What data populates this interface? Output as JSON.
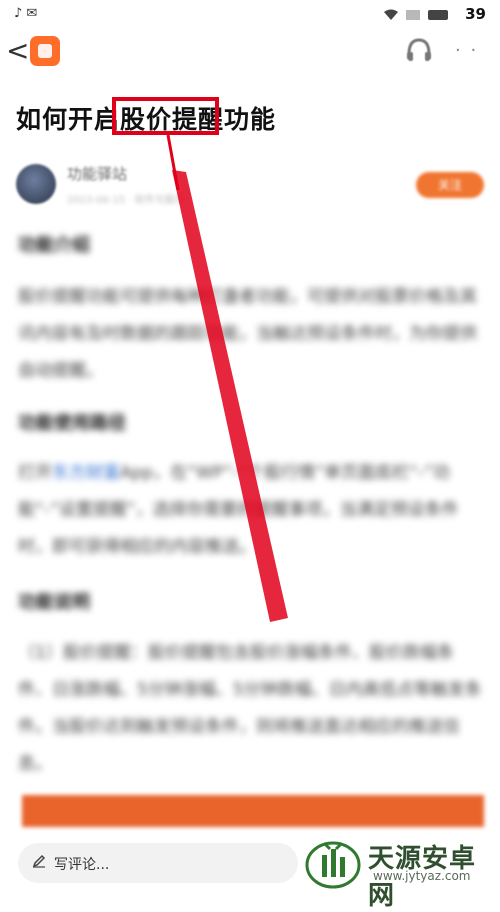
{
  "status": {
    "left_icons": "♪ ✉",
    "time": "39"
  },
  "nav": {
    "back": "<"
  },
  "article": {
    "title": "如何开启股价提醒功能",
    "author_name": "功能驿站",
    "author_meta": "2023-06-15 · 软件与服务",
    "follow_label": "关注",
    "h1": "功能介绍",
    "p1": "股价提醒功能可提供每种灯盏者功能，可提供对股票价格及其讯内容有及时数据的跟踪功能，当触达预设条件时，为你提供自动提醒。",
    "h2": "功能使用路径",
    "p2_a": "打开",
    "p2_link": "东方财富",
    "p2_b": "App，在“WP”-“个股行情”单页面底栏“-”功能“-”设置提醒”，选择你需要的提醒事项，当满足预设条件时，即可获得相应的内容推送。",
    "h3": "功能说明",
    "p3": "（1）股价提醒：股价提醒包含股价涨幅条件、股价跌幅条件、日涨跌幅、5分钟涨幅、5分钟跌幅、日内高低点等触发条件。当股价达到触发预设条件，则将推送直达相应的推送信息。"
  },
  "bottom": {
    "comment_label": "写评论..."
  },
  "watermark": {
    "text": "天源安卓网",
    "url": "www.jytyaz.com"
  },
  "colors": {
    "accent": "#f07530",
    "highlight": "#e0001a",
    "link": "#2f6fd1"
  }
}
